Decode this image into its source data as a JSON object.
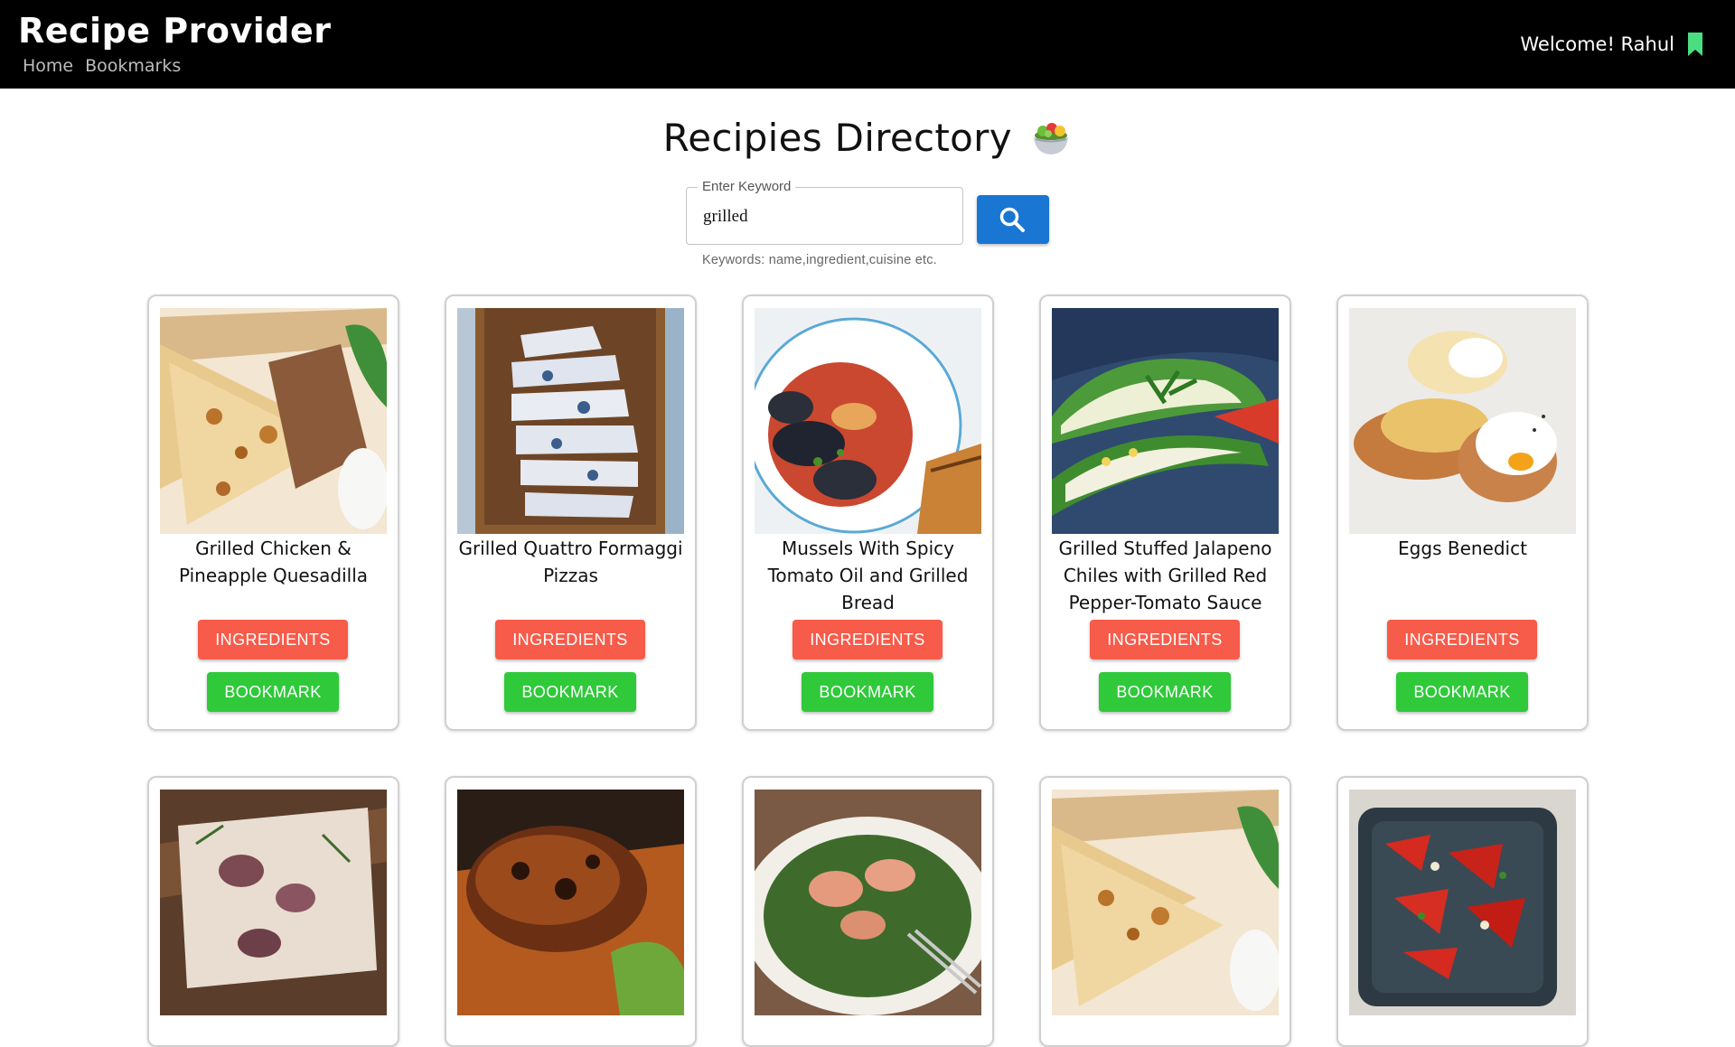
{
  "header": {
    "brand": "Recipe Provider",
    "nav": [
      "Home",
      "Bookmarks"
    ],
    "welcome": "Welcome! Rahul",
    "bookmark_icon": "bookmark-icon",
    "bookmark_color": "#4ade80"
  },
  "main": {
    "title": "Recipies Directory",
    "title_icon": "salad-bowl-icon"
  },
  "search": {
    "label": "Enter Keyword",
    "value": "grilled",
    "helper": "Keywords: name,ingredient,cuisine etc.",
    "button_icon": "search-icon",
    "button_color": "#1976d2"
  },
  "buttons": {
    "ingredients": "INGREDIENTS",
    "bookmark": "BOOKMARK",
    "ingredients_color": "#f75b4a",
    "bookmark_color": "#2fc93a"
  },
  "recipes": [
    {
      "title": "Grilled Chicken & Pineapple Quesadilla"
    },
    {
      "title": "Grilled Quattro Formaggi Pizzas"
    },
    {
      "title": "Mussels With Spicy Tomato Oil and Grilled Bread"
    },
    {
      "title": "Grilled Stuffed Jalapeno Chiles with Grilled Red Pepper-Tomato Sauce"
    },
    {
      "title": "Eggs Benedict"
    },
    {
      "title": ""
    },
    {
      "title": ""
    },
    {
      "title": ""
    },
    {
      "title": ""
    },
    {
      "title": ""
    }
  ]
}
